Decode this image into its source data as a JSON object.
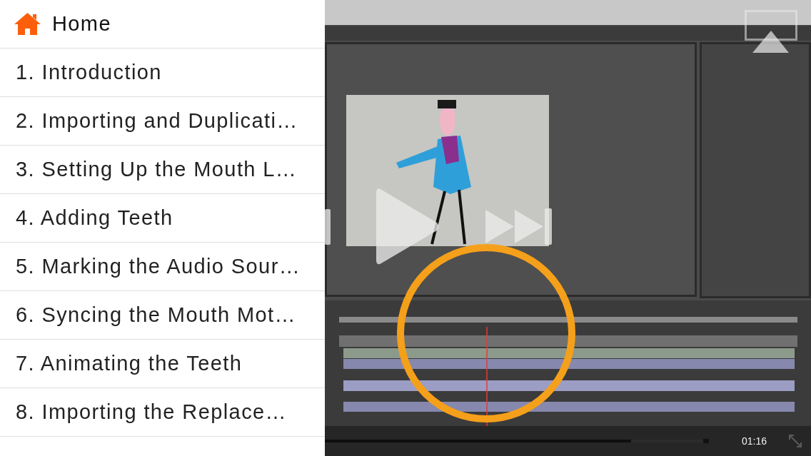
{
  "sidebar": {
    "home": {
      "label": "Home"
    },
    "lessons": [
      {
        "title": "1. Introduction"
      },
      {
        "title": "2. Importing and Duplicati…"
      },
      {
        "title": "3. Setting Up the Mouth L…"
      },
      {
        "title": "4. Adding Teeth"
      },
      {
        "title": "5. Marking the Audio Sour…"
      },
      {
        "title": "6. Syncing the Mouth Mot…"
      },
      {
        "title": "7. Animating the Teeth"
      },
      {
        "title": "8. Importing the Replace…"
      }
    ]
  },
  "player": {
    "progress": {
      "level": 0.81
    },
    "time": "01:16"
  }
}
